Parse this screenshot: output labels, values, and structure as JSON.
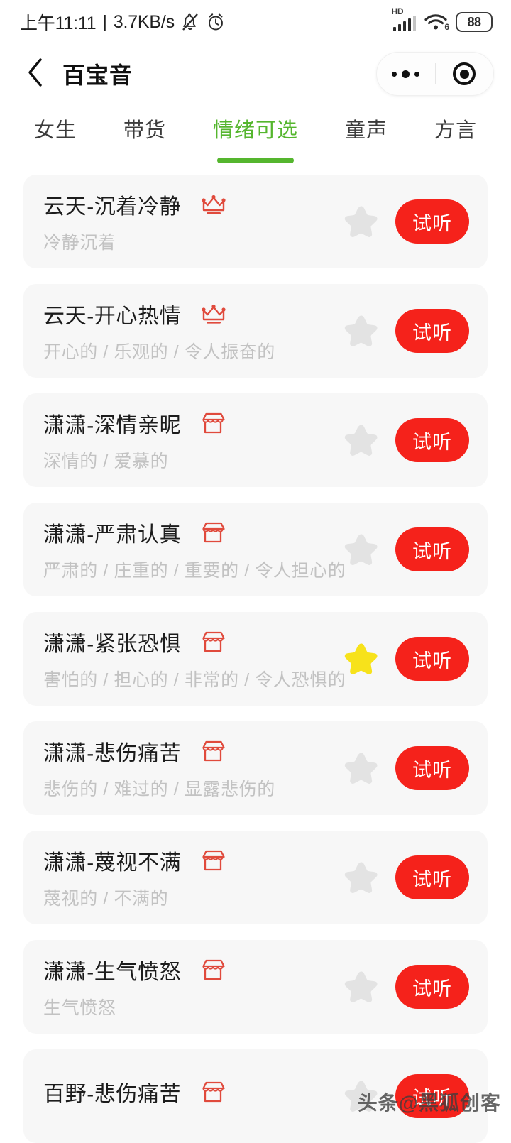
{
  "status_bar": {
    "time": "上午11:11",
    "separator": "|",
    "net_speed": "3.7KB/s",
    "bell_icon": "bell-muted-icon",
    "alarm_icon": "alarm-clock-icon",
    "hd_label": "HD",
    "signal_icon": "cellular-signal-icon",
    "wifi_icon": "wifi-icon",
    "wifi_generation": "6",
    "battery_level": "88"
  },
  "nav": {
    "back_icon": "chevron-left-icon",
    "title": "百宝音",
    "more_icon": "more-dots-icon",
    "close_icon": "target-circle-icon"
  },
  "tabs": {
    "active_index": 2,
    "items": [
      {
        "label": "女生"
      },
      {
        "label": "带货"
      },
      {
        "label": "情绪可选"
      },
      {
        "label": "童声"
      },
      {
        "label": "方言"
      }
    ]
  },
  "colors": {
    "accent_green": "#55b62e",
    "accent_red": "#f5221b",
    "badge_red": "#e04a3c",
    "star_on": "#f7e21b",
    "star_off": "#e3e3e3",
    "card_bg": "#f7f7f7"
  },
  "list": {
    "listen_label": "试听",
    "items": [
      {
        "title": "云天-沉着冷静",
        "subtitle": "冷静沉着",
        "badge": "crown-icon",
        "favorited": false,
        "action_label": "试听"
      },
      {
        "title": "云天-开心热情",
        "subtitle": "开心的 / 乐观的 / 令人振奋的",
        "badge": "crown-icon",
        "favorited": false,
        "action_label": "试听"
      },
      {
        "title": "潇潇-深情亲昵",
        "subtitle": "深情的 / 爱慕的",
        "badge": "shop-icon",
        "favorited": false,
        "action_label": "试听"
      },
      {
        "title": "潇潇-严肃认真",
        "subtitle": "严肃的 / 庄重的 / 重要的 / 令人担心的",
        "badge": "shop-icon",
        "favorited": false,
        "action_label": "试听"
      },
      {
        "title": "潇潇-紧张恐惧",
        "subtitle": "害怕的 / 担心的 / 非常的 / 令人恐惧的",
        "badge": "shop-icon",
        "favorited": true,
        "action_label": "试听"
      },
      {
        "title": "潇潇-悲伤痛苦",
        "subtitle": "悲伤的 / 难过的 / 显露悲伤的",
        "badge": "shop-icon",
        "favorited": false,
        "action_label": "试听"
      },
      {
        "title": "潇潇-蔑视不满",
        "subtitle": "蔑视的 / 不满的",
        "badge": "shop-icon",
        "favorited": false,
        "action_label": "试听"
      },
      {
        "title": "潇潇-生气愤怒",
        "subtitle": "生气愤怒",
        "badge": "shop-icon",
        "favorited": false,
        "action_label": "试听"
      },
      {
        "title": "百野-悲伤痛苦",
        "subtitle": "",
        "badge": "shop-icon",
        "favorited": false,
        "action_label": "试听"
      }
    ]
  },
  "watermark": {
    "text": "头条@黑狐创客"
  }
}
